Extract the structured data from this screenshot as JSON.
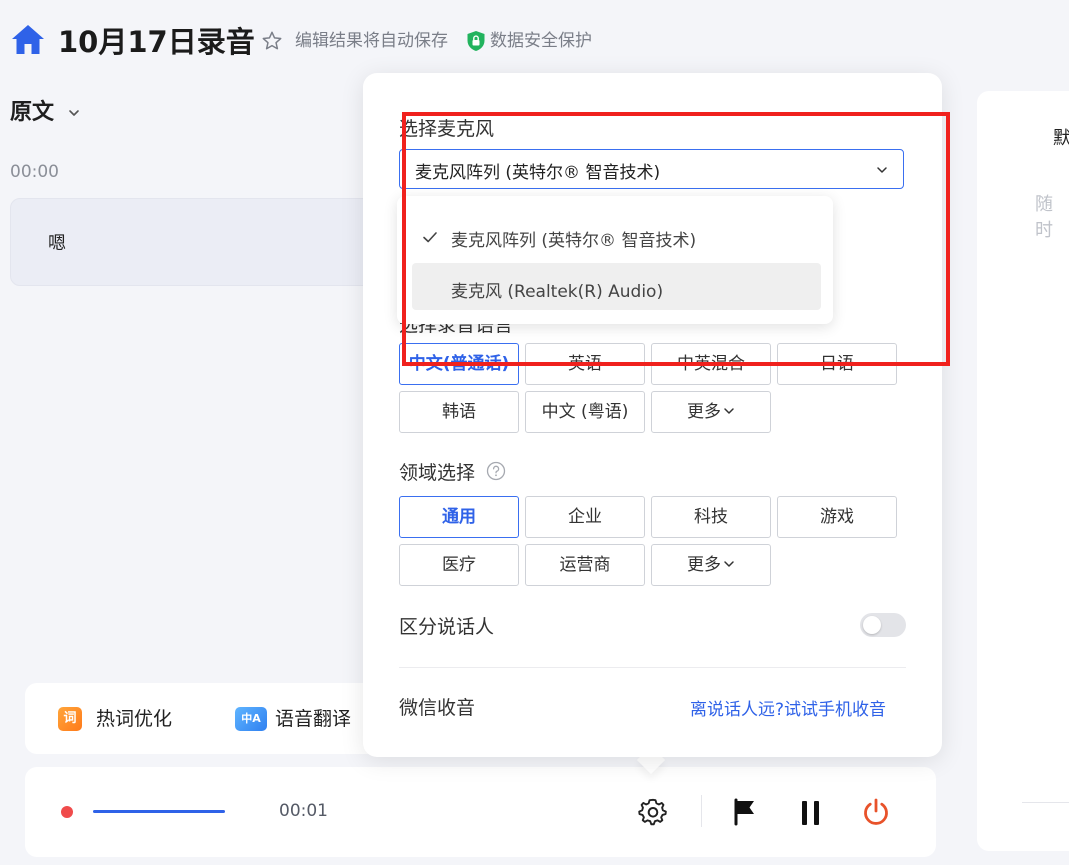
{
  "header": {
    "title": "10月17日录音",
    "autosave_note": "编辑结果将自动保存",
    "security_note": "数据安全保护"
  },
  "left": {
    "view_label": "原文",
    "timestamp": "00:00",
    "transcript_text": "嗯"
  },
  "toolbar": {
    "hotword_icon": "词",
    "hotword_label": "热词优化",
    "translate_icon": "中A",
    "translate_label": "语音翻译"
  },
  "bottombar": {
    "elapsed": "00:01"
  },
  "right_panel": {
    "text1": "默",
    "text2": "随时"
  },
  "settings": {
    "mic_label": "选择麦克风",
    "mic_selected": "麦克风阵列 (英特尔® 智音技术)",
    "mic_options": [
      "麦克风阵列 (英特尔® 智音技术)",
      "麦克风 (Realtek(R) Audio)"
    ],
    "language_label_partial": "选择录音语言",
    "languages": [
      "中文(普通话)",
      "英语",
      "中英混合",
      "日语",
      "韩语",
      "中文 (粤语)",
      "更多"
    ],
    "domain_label": "领域选择",
    "domains": [
      "通用",
      "企业",
      "科技",
      "游戏",
      "医疗",
      "运营商",
      "更多"
    ],
    "speaker_label": "区分说话人",
    "speaker_enabled": false,
    "wechat_label": "微信收音",
    "wechat_link": "离说话人远?试试手机收音"
  },
  "colors": {
    "accent": "#2f62e8",
    "highlight": "#f0211d",
    "record": "#f04b4b",
    "stop": "#e8522a"
  }
}
